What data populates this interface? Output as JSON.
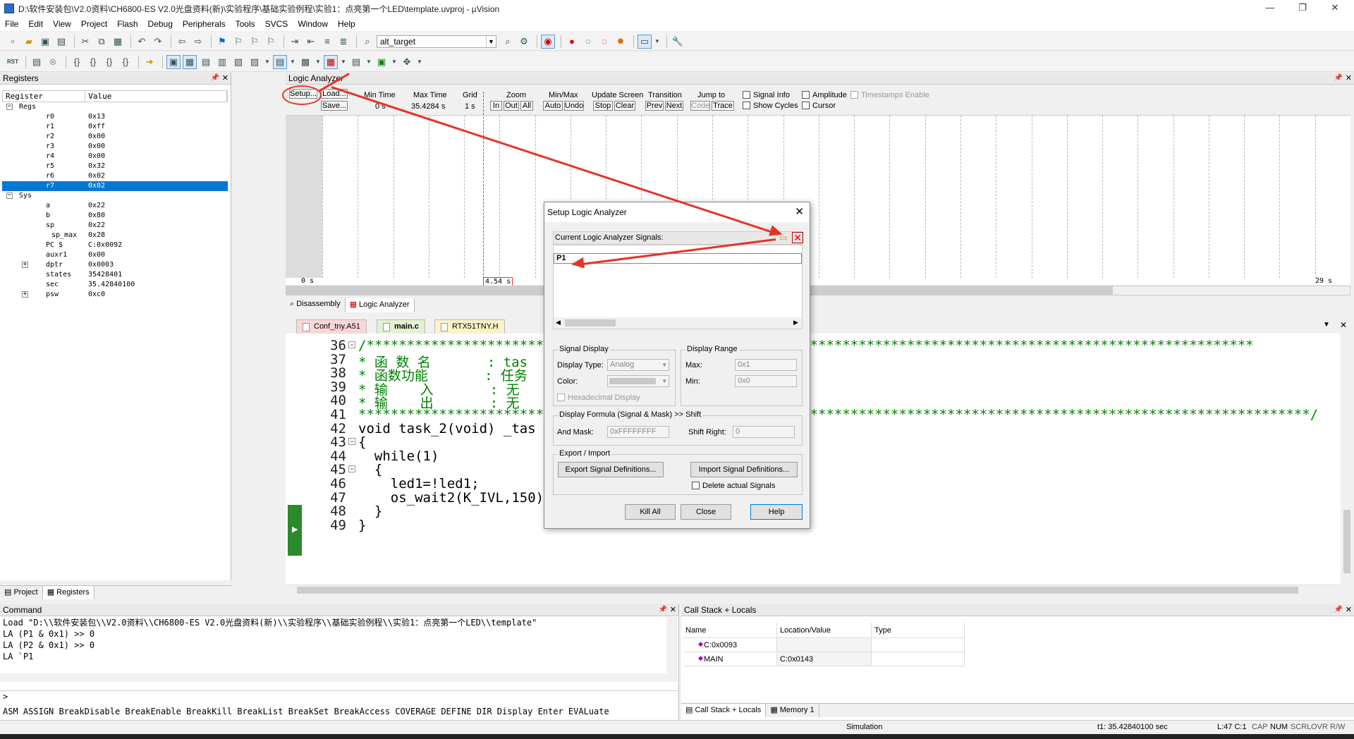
{
  "window": {
    "title": "D:\\软件安装包\\V2.0资料\\CH6800-ES V2.0光盘资料(新)\\实验程序\\基础实验例程\\实验1：点亮第一个LED\\template.uvproj - µVision",
    "minimize": "—",
    "maximize": "❐",
    "close": "✕"
  },
  "menu": [
    "File",
    "Edit",
    "View",
    "Project",
    "Flash",
    "Debug",
    "Peripherals",
    "Tools",
    "SVCS",
    "Window",
    "Help"
  ],
  "toolbar": {
    "target": "alt_target",
    "rst": "RST"
  },
  "registers": {
    "title": "Registers",
    "col_register": "Register",
    "col_value": "Value",
    "rows": [
      {
        "name": "Regs",
        "value": "",
        "level": 0,
        "toggle": "−"
      },
      {
        "name": "r0",
        "value": "0x13",
        "level": 2
      },
      {
        "name": "r1",
        "value": "0xff",
        "level": 2
      },
      {
        "name": "r2",
        "value": "0x00",
        "level": 2
      },
      {
        "name": "r3",
        "value": "0x00",
        "level": 2
      },
      {
        "name": "r4",
        "value": "0x00",
        "level": 2
      },
      {
        "name": "r5",
        "value": "0x32",
        "level": 2
      },
      {
        "name": "r6",
        "value": "0x02",
        "level": 2
      },
      {
        "name": "r7",
        "value": "0x02",
        "level": 2,
        "selected": true
      },
      {
        "name": "Sys",
        "value": "",
        "level": 0,
        "toggle": "−"
      },
      {
        "name": "a",
        "value": "0x22",
        "level": 2
      },
      {
        "name": "b",
        "value": "0x80",
        "level": 2
      },
      {
        "name": "sp",
        "value": "0x22",
        "level": 2
      },
      {
        "name": "sp_max",
        "value": "0x28",
        "level": 3
      },
      {
        "name": "PC  $",
        "value": "C:0x0092",
        "level": 2
      },
      {
        "name": "auxr1",
        "value": "0x00",
        "level": 2
      },
      {
        "name": "dptr",
        "value": "0x0003",
        "level": 2,
        "toggle": "+"
      },
      {
        "name": "states",
        "value": "35428401",
        "level": 2
      },
      {
        "name": "sec",
        "value": "35.42840100",
        "level": 2
      },
      {
        "name": "psw",
        "value": "0xc0",
        "level": 2,
        "toggle": "+"
      }
    ],
    "tabs": [
      "Project",
      "Registers"
    ]
  },
  "logic": {
    "title": "Logic Analyzer",
    "setup": "Setup...",
    "load": "Load...",
    "save": "Save...",
    "min_time_label": "Min Time",
    "min_time": "0 s",
    "max_time_label": "Max Time",
    "max_time": "35.4284 s",
    "grid_label": "Grid",
    "grid": "1 s",
    "zoom_label": "Zoom",
    "zoom_in": "In",
    "zoom_out": "Out",
    "zoom_all": "All",
    "minmax_label": "Min/Max",
    "auto": "Auto",
    "undo": "Undo",
    "update_label": "Update Screen",
    "stop": "Stop",
    "clear": "Clear",
    "transition_label": "Transition",
    "prev": "Prev",
    "next": "Next",
    "jump_label": "Jump to",
    "code": "Code",
    "trace": "Trace",
    "signal_info": "Signal Info",
    "show_cycles": "Show Cycles",
    "amplitude": "Amplitude",
    "cursor": "Cursor",
    "timestamps": "Timestamps Enable",
    "t_start": "0 s",
    "t_cursor": "4.54 s",
    "t_end": "29 s",
    "tabs": [
      "Disassembly",
      "Logic Analyzer"
    ]
  },
  "editor": {
    "tabs": [
      "Conf_tny.A51",
      "main.c",
      "RTX51TNY.H"
    ],
    "lines": [
      {
        "n": "36",
        "text": "/**************************************************************************************************************"
      },
      {
        "n": "37",
        "text": "* 函 数 名       : tas"
      },
      {
        "n": "38",
        "text": "* 函数功能       : 任务"
      },
      {
        "n": "39",
        "text": "* 输    入       : 无"
      },
      {
        "n": "40",
        "text": "* 输    出       : 无"
      },
      {
        "n": "41",
        "text": "**********************************************************************************************************************/"
      },
      {
        "n": "42",
        "text": "void task_2(void) _tas"
      },
      {
        "n": "43",
        "text": "{"
      },
      {
        "n": "44",
        "text": "  while(1)"
      },
      {
        "n": "45",
        "text": "  {"
      },
      {
        "n": "46",
        "text": "    led1=!led1;"
      },
      {
        "n": "47",
        "text": "    os_wait2(K_IVL,150);"
      },
      {
        "n": "48",
        "text": "  }"
      },
      {
        "n": "49",
        "text": "}"
      }
    ]
  },
  "dialog": {
    "title": "Setup Logic Analyzer",
    "signals_label": "Current Logic Analyzer Signals:",
    "signal": "P1",
    "signal_display": "Signal Display",
    "display_type_label": "Display Type:",
    "display_type": "Analog",
    "color_label": "Color:",
    "hex_display": "Hexadecimal Display",
    "display_range": "Display Range",
    "max_label": "Max:",
    "max": "0x1",
    "min_label": "Min:",
    "min": "0x0",
    "formula": "Display Formula (Signal & Mask) >> Shift",
    "and_mask_label": "And Mask:",
    "and_mask": "0xFFFFFFFF",
    "shift_right_label": "Shift Right:",
    "shift_right": "0",
    "export_import": "Export / Import",
    "export_btn": "Export Signal Definitions...",
    "import_btn": "Import Signal Definitions...",
    "delete_signals": "Delete actual Signals",
    "kill_all": "Kill All",
    "close": "Close",
    "help": "Help"
  },
  "command": {
    "title": "Command",
    "lines": [
      "Load \"D:\\\\软件安装包\\\\V2.0资料\\\\CH6800-ES V2.0光盘资料(新)\\\\实验程序\\\\基础实验例程\\\\实验1：点亮第一个LED\\\\template\"",
      "LA (P1 & 0x1) >> 0",
      "LA (P2 & 0x1) >> 0",
      "LA `P1"
    ],
    "prompt": ">",
    "keywords": "ASM ASSIGN BreakDisable BreakEnable BreakKill BreakList BreakSet BreakAccess COVERAGE DEFINE DIR Display Enter EVALuate"
  },
  "callstack": {
    "title": "Call Stack + Locals",
    "col_name": "Name",
    "col_location": "Location/Value",
    "col_type": "Type",
    "rows": [
      {
        "name": "C:0x0093",
        "loc": "",
        "type": ""
      },
      {
        "name": "MAIN",
        "loc": "C:0x0143",
        "type": ""
      }
    ],
    "tabs": [
      "Call Stack + Locals",
      "Memory 1"
    ]
  },
  "status": {
    "mode": "Simulation",
    "time": "t1: 35.42840100 sec",
    "pos": "L:47 C:1",
    "caps": "CAP",
    "num": "NUM",
    "scrl": "SCRL",
    "ovr": "OVR",
    "rw": "R/W"
  },
  "colors": {
    "accent": "#0078d7",
    "arrow": "#e8322a",
    "comment": "#008000",
    "keyword": "#0000ff"
  }
}
